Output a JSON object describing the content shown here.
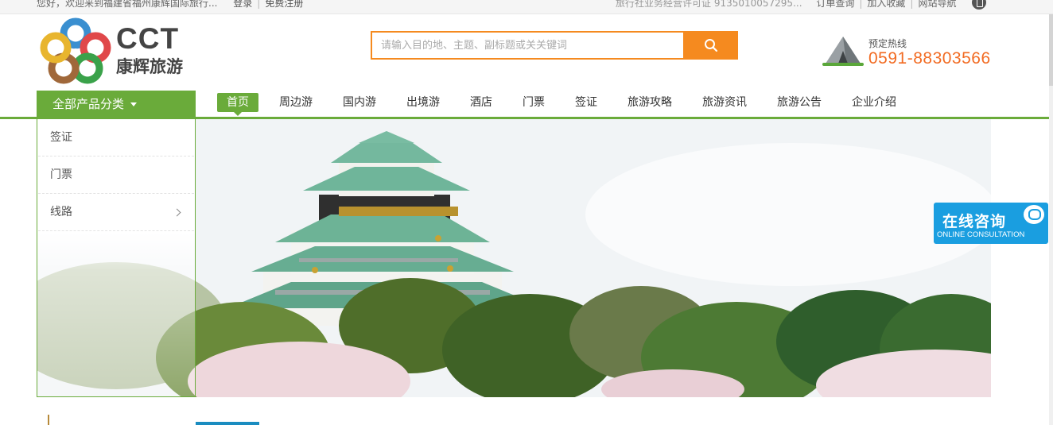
{
  "topbar": {
    "welcome": "您好，欢迎来到福建省福州康辉国际旅行...",
    "login": "登录",
    "register": "免费注册",
    "license": "旅行社业务经营许可证  9135010057295...",
    "order_query": "订单查询",
    "add_favorite": "加入收藏",
    "site_nav": "网站导航"
  },
  "logo": {
    "brand_en": "CCT",
    "brand_cn": "康辉旅游"
  },
  "search": {
    "placeholder": "请输入目的地、主题、副标题或关关键词"
  },
  "hotline": {
    "label": "预定热线",
    "number": "0591-88303566"
  },
  "nav": {
    "all_categories": "全部产品分类",
    "items": [
      "首页",
      "周边游",
      "国内游",
      "出境游",
      "酒店",
      "门票",
      "签证",
      "旅游攻略",
      "旅游资讯",
      "旅游公告",
      "企业介绍"
    ]
  },
  "categories": [
    "签证",
    "门票",
    "线路"
  ],
  "consult": {
    "title": "在线咨询",
    "subtitle": "ONLINE CONSULTATION"
  },
  "colors": {
    "accent_green": "#6aab3a",
    "accent_orange": "#f58a1f",
    "hotline_orange": "#f26b22",
    "consult_blue": "#1a9ee0"
  }
}
